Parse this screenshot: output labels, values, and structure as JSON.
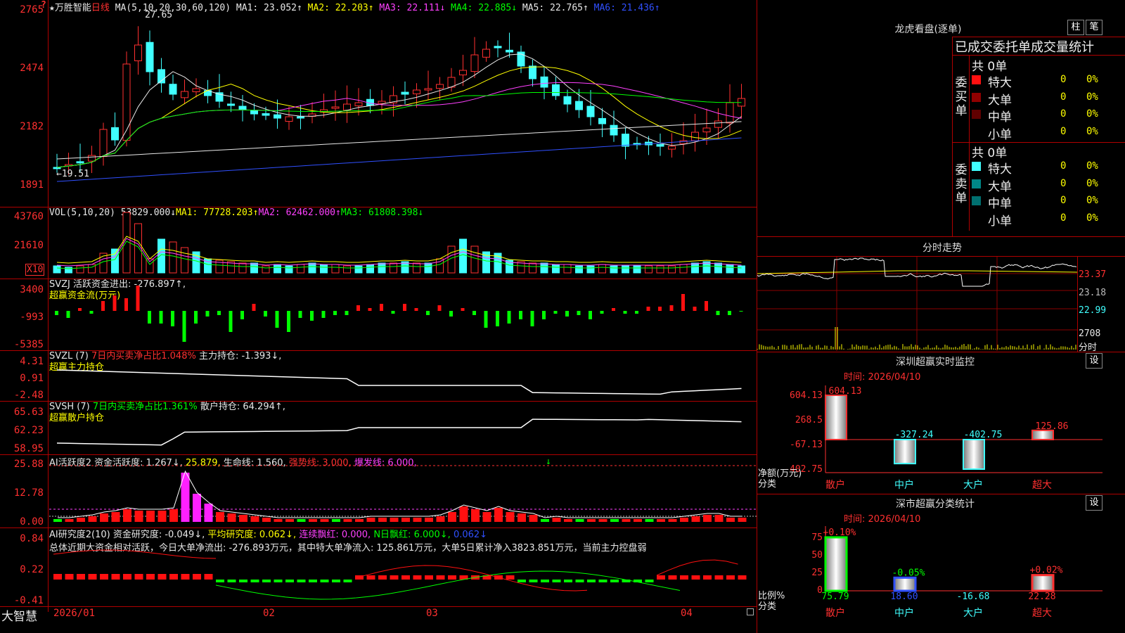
{
  "stock": {
    "star": "★",
    "name": "万胜智能",
    "period": "日线",
    "unlock_icon": "?"
  },
  "main": {
    "axis": [
      "2765",
      "2474",
      "2182",
      "1891"
    ],
    "ma_title": "MA(5,10,20,30,60,120)",
    "ma": [
      {
        "label": "MA1:",
        "value": "23.052↑",
        "color": "#e8e8e8"
      },
      {
        "label": "MA2:",
        "value": "22.203↑",
        "color": "#ffff00"
      },
      {
        "label": "MA3:",
        "value": "22.111↓",
        "color": "#ff40ff"
      },
      {
        "label": "MA4:",
        "value": "22.885↓",
        "color": "#00ff00"
      },
      {
        "label": "MA5:",
        "value": "22.765↑",
        "color": "#e8e8e8"
      },
      {
        "label": "MA6:",
        "value": "21.436↑",
        "color": "#3050ff"
      }
    ],
    "high_label": "27.65",
    "low_label": "19.51"
  },
  "vol": {
    "title": "VOL(5,10,20)",
    "value": "53829.000↓",
    "ma1": "MA1: 77728.203↑",
    "ma2": "MA2: 62462.000↑",
    "ma3": "MA3: 61808.398↓",
    "axis": [
      "43760",
      "21610"
    ],
    "unit": "X10"
  },
  "svzj": {
    "title": "SVZJ  活跃资金进出: -276.897↑,",
    "sub": "超赢资金流(万元)",
    "axis": [
      "3400",
      "-993",
      "-5385"
    ]
  },
  "svzl": {
    "title": "SVZL (7)",
    "part2": "7日内买卖净占比1.048%",
    "part3": "主力持仓: -1.393↓,",
    "sub": "超赢主力持仓",
    "axis": [
      "4.31",
      "0.91",
      "-2.48"
    ]
  },
  "svsh": {
    "title": "SVSH (7)",
    "part2": "7日内买卖净占比1.361%",
    "part3": "散户持仓: 64.294↑,",
    "sub": "超赢散户持仓",
    "axis": [
      "65.63",
      "62.23",
      "58.95"
    ]
  },
  "ai1": {
    "title": "AI活跃度2 资金活跃度: 1.267↓,",
    "v2": "25.879,",
    "v3": "生命线: 1.560,",
    "v4": "强势线: 3.000,",
    "v5": "爆发线: 6.000,",
    "axis": [
      "25.88",
      "12.78",
      "0.00"
    ]
  },
  "ai2": {
    "title": "AI研究度2(10) 资金研究度: -0.049↓,",
    "v2": "平均研究度: 0.062↓,",
    "v3": "连续飘红: 0.000,",
    "v4": "N日飘红: 6.000↓,",
    "v5": "0.062↓",
    "summary": "总体近期大资金相对活跃，今日大单净流出: -276.893万元，其中特大单净流入: 125.861万元，大单5日累计净入3823.851万元，当前主力控盘弱",
    "axis": [
      "0.84",
      "0.22",
      "-0.41"
    ]
  },
  "xaxis": {
    "brand": "大智慧",
    "labels": [
      "2026/01",
      "02",
      "03",
      "04"
    ]
  },
  "dragon": {
    "title": "龙虎看盘(逐单)",
    "btn1": "柱",
    "btn2": "笔",
    "header": "已成交委托单成交量统计",
    "buy_side": "委买单",
    "sell_side": "委卖单",
    "buy_total": "共 0单",
    "sell_total": "共 0单",
    "buy_rows": [
      {
        "label": "特大",
        "num": "0",
        "pct": "0%",
        "color": "#ff1010"
      },
      {
        "label": "大单",
        "num": "0",
        "pct": "0%",
        "color": "#900000"
      },
      {
        "label": "中单",
        "num": "0",
        "pct": "0%",
        "color": "#600000"
      },
      {
        "label": "小单",
        "num": "0",
        "pct": "0%",
        "color": ""
      }
    ],
    "sell_rows": [
      {
        "label": "特大",
        "num": "0",
        "pct": "0%",
        "color": "#40ffff"
      },
      {
        "label": "大单",
        "num": "0",
        "pct": "0%",
        "color": "#008888"
      },
      {
        "label": "中单",
        "num": "0",
        "pct": "0%",
        "color": "#007070"
      },
      {
        "label": "小单",
        "num": "0",
        "pct": "0%",
        "color": ""
      }
    ]
  },
  "intraday": {
    "title": "分时走势",
    "axis": [
      "23.37",
      "23.18",
      "22.99",
      "2708"
    ],
    "unit": "分时"
  },
  "monitor": {
    "title": "深圳超赢实时监控",
    "btn": "设",
    "date": "时间: 2026/04/10",
    "axis": [
      "604.13",
      "268.5",
      "-67.13",
      "-402.75"
    ],
    "ylabel": "净额(万元)",
    "xlabel": "分类",
    "cats": [
      "散户",
      "中户",
      "大户",
      "超大"
    ],
    "vals": [
      "604.13",
      "-327.24",
      "-402.75",
      "125.86"
    ]
  },
  "classify": {
    "title": "深市超赢分类统计",
    "btn": "设",
    "date": "时间: 2026/04/10",
    "axis": [
      "75",
      "50",
      "25",
      "0"
    ],
    "ylabel": "比例%",
    "xlabel": "分类",
    "cats": [
      "散户",
      "中户",
      "大户",
      "超大"
    ],
    "pcts": [
      "+0.10%",
      "-0.05%",
      "",
      "+0.02%"
    ],
    "vals": [
      "75.79",
      "18.60",
      "-16.68",
      "22.28"
    ]
  }
}
